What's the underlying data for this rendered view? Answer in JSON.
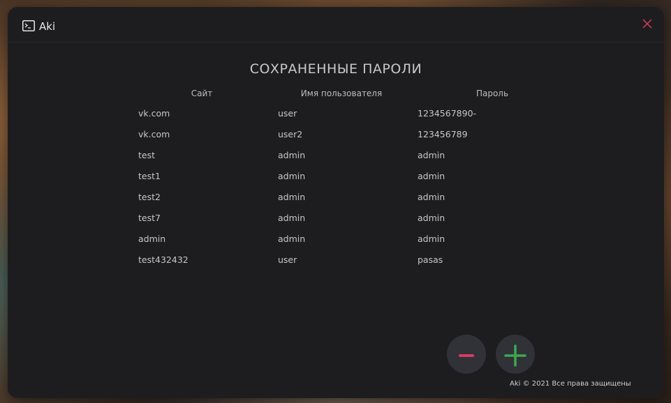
{
  "window": {
    "title": "Aki",
    "icons": {
      "app": "terminal-icon",
      "close": "close-icon"
    },
    "colors": {
      "accent": "#d93a63",
      "add": "#3ea84f",
      "background": "#1d1d1f"
    }
  },
  "page": {
    "title": "СОХРАНЕННЫЕ ПАРОЛИ",
    "columns": {
      "site": "Сайт",
      "username": "Имя пользователя",
      "password": "Пароль"
    }
  },
  "rows": [
    {
      "site": "vk.com",
      "username": "user",
      "password": "1234567890-"
    },
    {
      "site": "vk.com",
      "username": "user2",
      "password": "123456789"
    },
    {
      "site": "test",
      "username": "admin",
      "password": "admin"
    },
    {
      "site": "test1",
      "username": "admin",
      "password": "admin"
    },
    {
      "site": "test2",
      "username": "admin",
      "password": "admin"
    },
    {
      "site": "test7",
      "username": "admin",
      "password": "admin"
    },
    {
      "site": "admin",
      "username": "admin",
      "password": "admin"
    },
    {
      "site": "test432432",
      "username": "user",
      "password": "pasas"
    }
  ],
  "actions": {
    "remove_icon": "minus-icon",
    "add_icon": "plus-icon"
  },
  "footer": {
    "text": "Aki © 2021 Все права защищены"
  }
}
